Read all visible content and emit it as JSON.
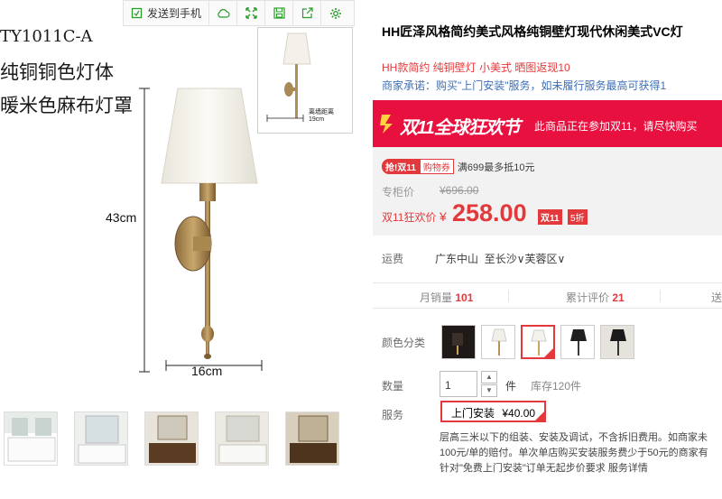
{
  "toolbar": {
    "send_label": "发送到手机",
    "icons": [
      "send-phone-icon",
      "cloud-icon",
      "expand-icon",
      "save-icon",
      "share-icon",
      "gear-icon"
    ]
  },
  "gallery": {
    "spec_lines": [
      "TY1011C-A",
      "纯铜铜色灯体",
      "暖米色麻布灯罩"
    ],
    "height_label": "43cm",
    "width_label": "16cm",
    "inset": {
      "wall_label": "离墙距离",
      "depth_label": "19cm"
    },
    "thumbnail_count": 5
  },
  "product": {
    "title": "HH匠泽风格简约美式风格纯铜壁灯现代休闲美式VC灯",
    "subtitle": "HH款简约 纯铜壁灯 小美式 晒图返现10",
    "promise": "商家承诺：购买\"上门安装\"服务，如未履行服务最高可获得1"
  },
  "banner": {
    "brand": "双11全球狂欢节",
    "note": "此商品正在参加双11，请尽快购买",
    "color": "#e8103f"
  },
  "price": {
    "coupon_tag": "抢!双11",
    "coupon_type": "购物券",
    "coupon_text": "满699最多抵10元",
    "orig_label": "专柜价",
    "orig_value": "¥696.00",
    "festival_label": "双11狂欢价",
    "currency": "¥",
    "value": "258.00",
    "badge_d11": "双11",
    "discount": "5折",
    "accent": "#e4393c"
  },
  "shipping": {
    "label": "运费",
    "from": "广东中山",
    "to": "至长沙∨芙蓉区∨"
  },
  "stats": {
    "monthly_label": "月销量",
    "monthly_value": "101",
    "reviews_label": "累计评价",
    "reviews_value": "21",
    "third_label": "送天"
  },
  "options": {
    "color_label": "颜色分类",
    "swatch_count": 5,
    "selected_index": 2,
    "qty_label": "数量",
    "qty_value": "1",
    "qty_unit": "件",
    "stock": "库存120件",
    "service_label": "服务",
    "service_name": "上门安装",
    "service_price": "¥40.00"
  },
  "service_desc": [
    "层高三米以下的组装、安装及调试，不含拆旧费用。如商家未",
    "100元/单的赔付。单次单店购买安装服务费少于50元的商家有",
    "针对\"免费上门安装\"订单无起步价要求 服务详情"
  ]
}
